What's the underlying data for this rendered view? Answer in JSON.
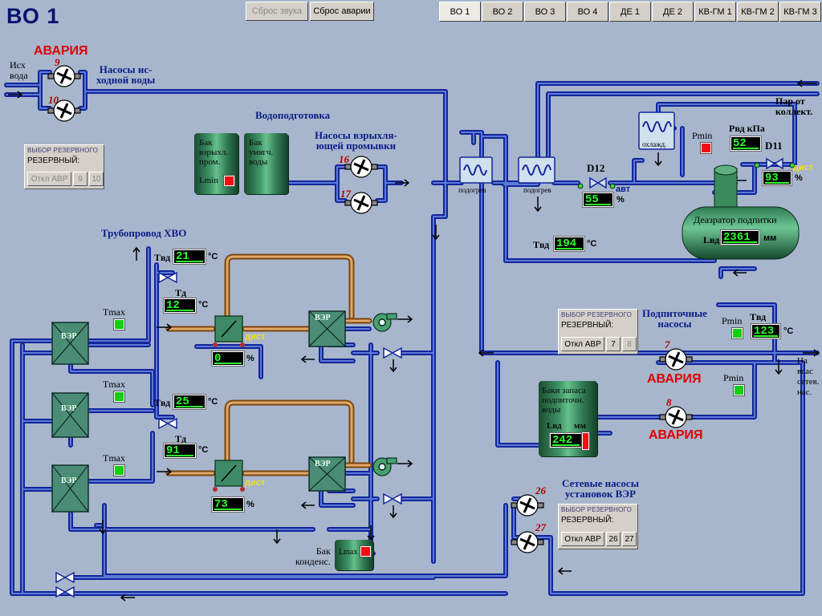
{
  "title": "ВО 1",
  "toolbar": {
    "reset_sound": "Сброс звука",
    "reset_alarm": "Сброс аварии"
  },
  "tabs": [
    "ВО 1",
    "ВО 2",
    "ВО 3",
    "ВО 4",
    "ДЕ 1",
    "ДЕ 2",
    "КВ-ГМ 1",
    "КВ-ГМ 2",
    "КВ-ГМ 3"
  ],
  "active_tab": "ВО 1",
  "labels": {
    "source_water": "Исх\nвода",
    "source_pumps": "Насосы ис-\nходной воды",
    "water_treatment": "Водоподготовка",
    "wash_pumps": "Насосы взрыхля-\nющей промывки",
    "hvo_pipeline": "Трубопровод ХВО",
    "steam_from": "Пар от\nколлект.",
    "heater1": "подогрев",
    "heater2": "подогрев",
    "cooler": "охлажд.",
    "deaerator": "Деазратор подпитки",
    "makeup_pumps": "Подпиточные\nнасосы",
    "to_suction": "На\nвсас\nсетев.\nнас.",
    "storage_tanks": "Баки запаса\nподпиточн.\nводы",
    "network_pumps": "Сетевые насосы\nустановок ВЭР",
    "condensate_tank": "Бак\nконденс.",
    "tank_wash": "Бак\nвзрыхл.\nпром.",
    "tank_soft": "Бак\nумягч.\nводы",
    "lmin": "Lmin",
    "lmax": "Lmax",
    "ver": "ВЭР",
    "tmax": "Tmax",
    "pmin": "Pmin",
    "d12": "D12",
    "d11": "D11",
    "avt": "авт",
    "dist": "дист",
    "lvd": "Lвд",
    "mm": "мм",
    "pvd_kpa": "Pвд  кПа",
    "tvd": "Tвд",
    "td": "Tд",
    "deg_c": "°C",
    "percent": "%"
  },
  "alarms": {
    "pumps_9_10": "АВАРИЯ",
    "pump_7": "АВАРИЯ",
    "pump_8": "АВАРИЯ"
  },
  "pump_numbers": {
    "p9": "9",
    "p10": "10",
    "p16": "16",
    "p17": "17",
    "p7": "7",
    "p8": "8",
    "p26": "26",
    "p27": "27"
  },
  "readouts": {
    "tvd_upper": "21",
    "td_upper": "12",
    "valve_upper_pct": "0",
    "tvd_lower": "25",
    "td_lower": "91",
    "valve_lower_pct": "73",
    "tvd_mid": "194",
    "d12_pct": "55",
    "pvd": "52",
    "d11_pct": "93",
    "lvd_deaerator": "2361",
    "tvd_makeup": "123",
    "lvd_storage": "242"
  },
  "avr_panels": {
    "source": {
      "header": "ВЫБОР РЕЗЕРВНОГО",
      "sub": "РЕЗЕРВНЫЙ:",
      "off": "Откл АВР",
      "a": "9",
      "b": "10"
    },
    "makeup": {
      "header": "ВЫБОР РЕЗЕРВНОГО",
      "sub": "РЕЗЕРВНЫЙ:",
      "off": "Откл АВР",
      "a": "7",
      "b": "8"
    },
    "network": {
      "header": "ВЫБОР РЕЗЕРВНОГО",
      "sub": "РЕЗЕРВНЫЙ:",
      "off": "Откл АВР",
      "a": "26",
      "b": "27"
    }
  },
  "colors": {
    "background": "#a7b6cc",
    "pipe": "#1a2fa8",
    "pipe_hot": "#c07a32",
    "readout_text": "#2cff2c",
    "alarm": "#e00000",
    "tank": "#2f7a52"
  }
}
